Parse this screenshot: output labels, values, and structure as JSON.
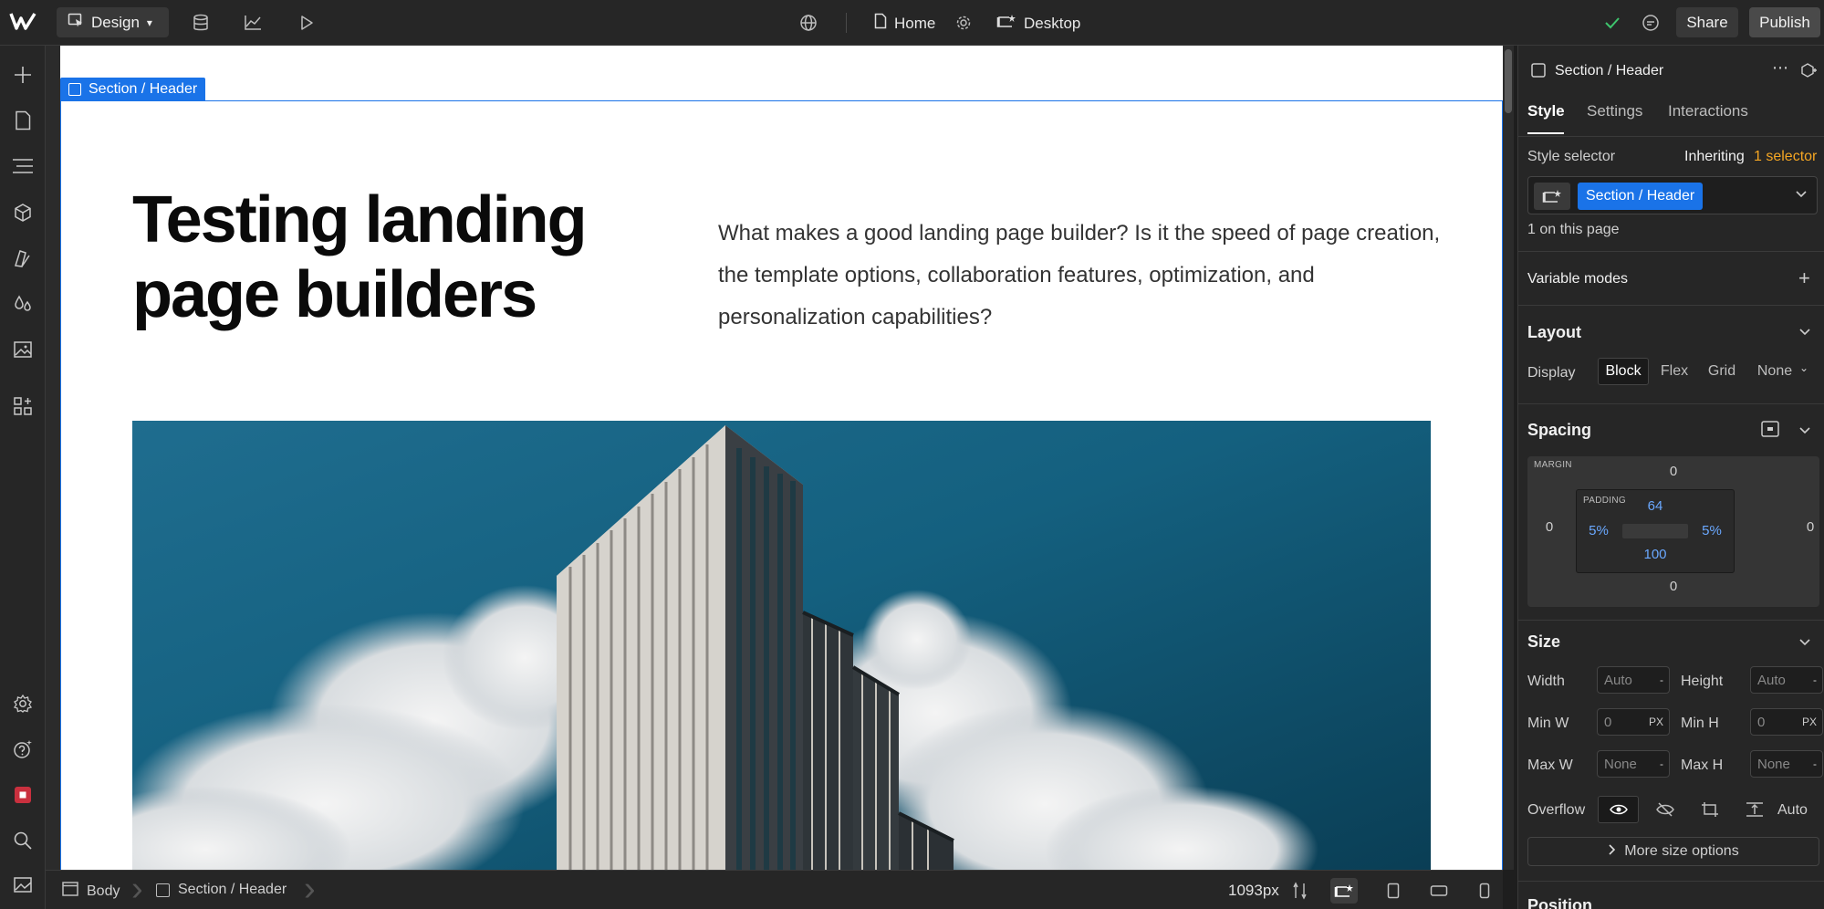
{
  "topbar": {
    "mode_label": "Design",
    "page_name": "Home",
    "breakpoint_label": "Desktop",
    "share_label": "Share",
    "publish_label": "Publish",
    "icons": [
      "webflow-logo-icon",
      "cursor-icon",
      "database-icon",
      "chart-icon",
      "play-icon",
      "globe-icon",
      "page-icon",
      "gear-icon",
      "desktop-icon",
      "check-icon",
      "comment-icon"
    ]
  },
  "left_rail": {
    "icons": [
      "add-icon",
      "pages-icon",
      "navigator-icon",
      "components-icon",
      "styles-icon",
      "variables-icon",
      "assets-icon",
      "apps-icon",
      "settings-icon",
      "help-icon",
      "stop-icon",
      "search-icon",
      "image-icon"
    ]
  },
  "canvas": {
    "selection_label": "Section / Header",
    "hero_title": "Testing landing page builders",
    "hero_description": "What makes a good landing page builder? Is it the speed of page creation, the template options, collaboration features, optimization, and personalization capabilities?"
  },
  "bottombar": {
    "crumb_body": "Body",
    "crumb_section": "Section / Header",
    "width_value": "1093px"
  },
  "panel": {
    "element_title": "Section / Header",
    "tabs": [
      "Style",
      "Settings",
      "Interactions"
    ],
    "style_selector_label": "Style selector",
    "inheriting_label": "Inheriting",
    "inheriting_count": "1 selector",
    "selector_chip": "Section / Header",
    "on_page": "1 on this page",
    "variable_modes": "Variable modes",
    "layout": {
      "heading": "Layout",
      "display_label": "Display",
      "display_options": [
        "Block",
        "Flex",
        "Grid",
        "None"
      ],
      "selected": "Block"
    },
    "spacing": {
      "heading": "Spacing",
      "margin_label": "MARGIN",
      "padding_label": "PADDING",
      "margin": {
        "top": "0",
        "right": "0",
        "bottom": "0",
        "left": "0"
      },
      "padding": {
        "top": "64",
        "right": "5%",
        "bottom": "100",
        "left": "5%"
      }
    },
    "size": {
      "heading": "Size",
      "width_label": "Width",
      "width_value": "Auto",
      "height_label": "Height",
      "height_value": "Auto",
      "minw_label": "Min W",
      "minw_value": "0",
      "minw_unit": "PX",
      "minh_label": "Min H",
      "minh_value": "0",
      "minh_unit": "PX",
      "maxw_label": "Max W",
      "maxw_value": "None",
      "maxh_label": "Max H",
      "maxh_value": "None",
      "dash": "-",
      "overflow_label": "Overflow",
      "overflow_auto": "Auto",
      "more_label": "More size options"
    },
    "position_heading": "Position"
  },
  "colors": {
    "accent": "#1a73e8",
    "panel_bg": "#262626",
    "canvas_bg": "#ffffff",
    "selector_highlight": "#f5a623",
    "success": "#3ec46d"
  }
}
